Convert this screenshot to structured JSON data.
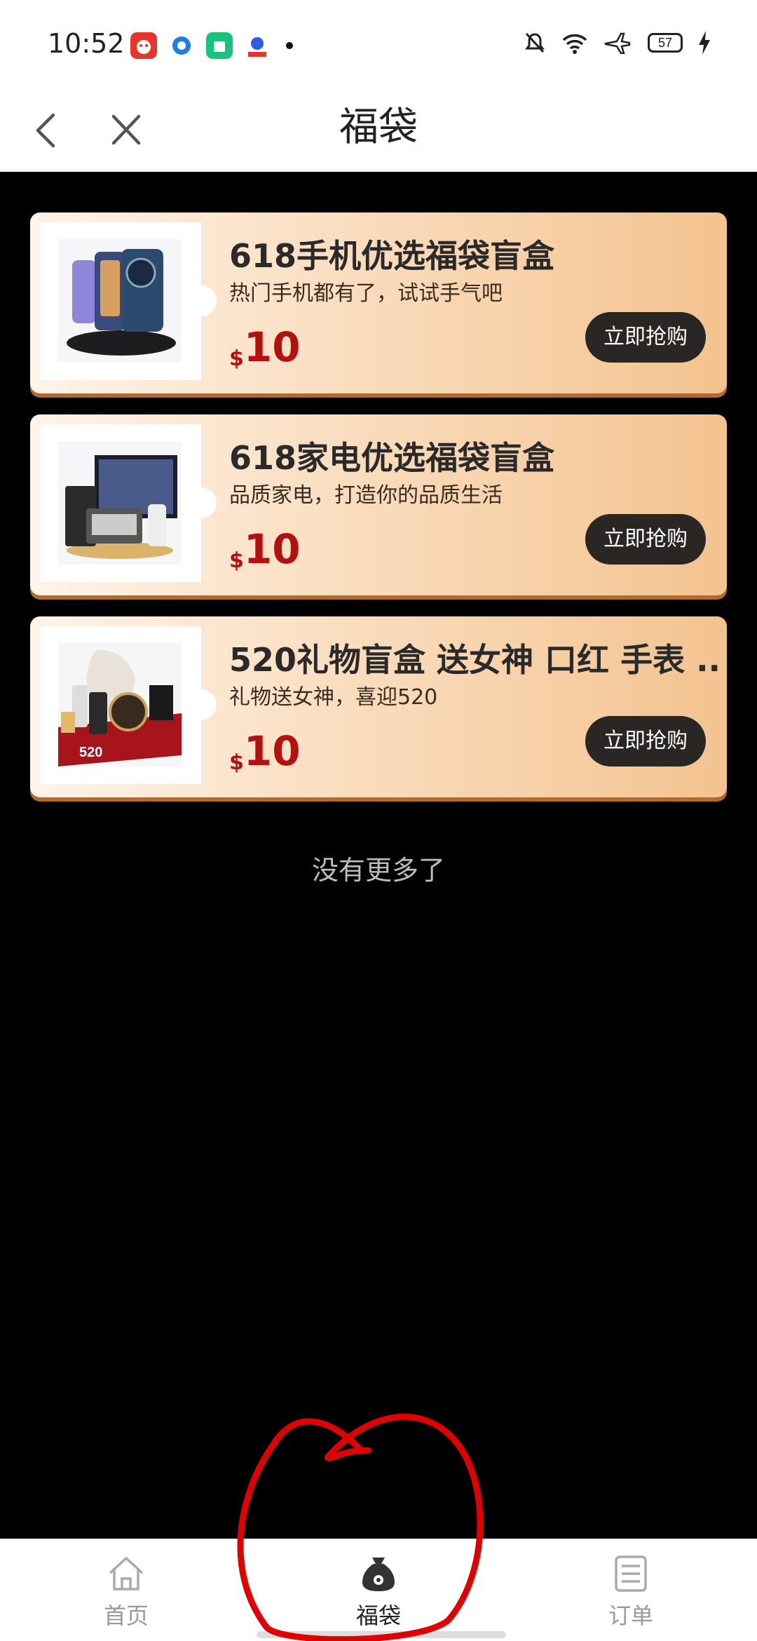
{
  "status_bar": {
    "time": "10:52",
    "battery": "57"
  },
  "header": {
    "title": "福袋"
  },
  "cards": [
    {
      "title": "618手机优选福袋盲盒",
      "subtitle": "热门手机都有了，试试手气吧",
      "currency": "$",
      "price": "10",
      "button": "立即抢购"
    },
    {
      "title": "618家电优选福袋盲盒",
      "subtitle": "品质家电，打造你的品质生活",
      "currency": "$",
      "price": "10",
      "button": "立即抢购"
    },
    {
      "title": "520礼物盲盒 送女神 口红 手表 ...",
      "subtitle": "礼物送女神，喜迎520",
      "currency": "$",
      "price": "10",
      "button": "立即抢购",
      "image_text": "520"
    }
  ],
  "footer_text": "没有更多了",
  "bottom_nav": [
    {
      "label": "首页",
      "icon": "home-icon"
    },
    {
      "label": "福袋",
      "icon": "lucky-bag-icon",
      "active": true
    },
    {
      "label": "订单",
      "icon": "orders-icon"
    }
  ],
  "colors": {
    "price": "#b50f0f",
    "button_bg": "#2a2624",
    "card_gradient_end": "#f3c38f",
    "annotation": "#e00000"
  }
}
